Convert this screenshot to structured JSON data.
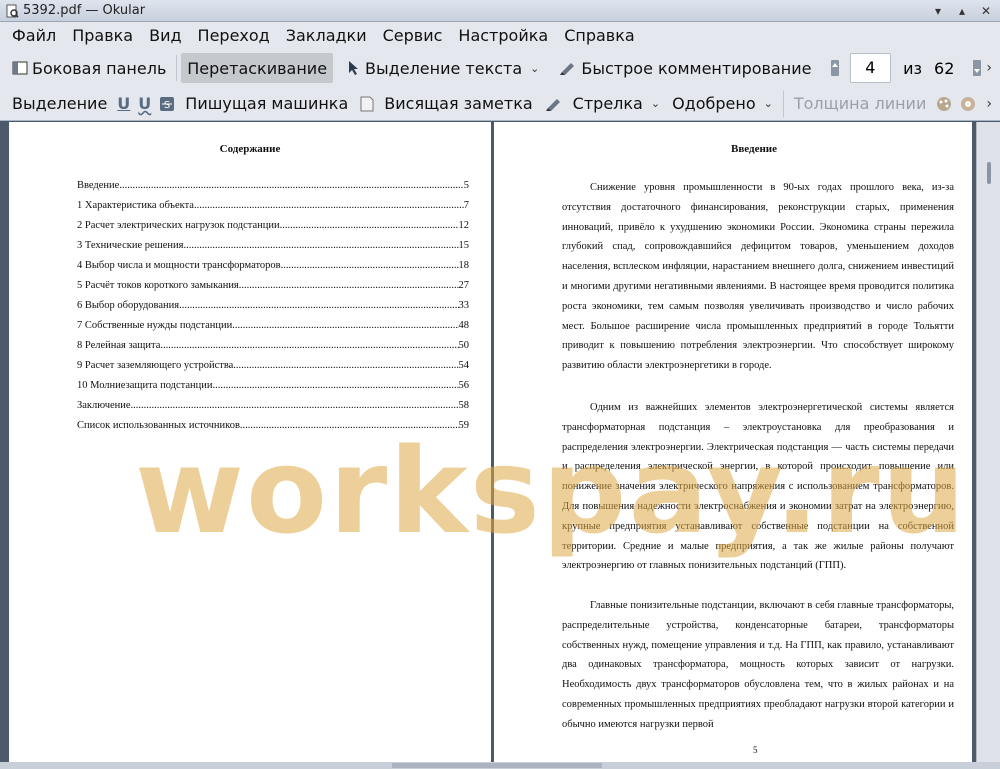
{
  "window": {
    "title": "5392.pdf  — Okular"
  },
  "menubar": [
    "Файл",
    "Правка",
    "Вид",
    "Переход",
    "Закладки",
    "Сервис",
    "Настройка",
    "Справка"
  ],
  "toolbar1": {
    "sidebar": "Боковая панель",
    "drag": "Перетаскивание",
    "text_select": "Выделение текста",
    "quick_comment": "Быстрое комментирование",
    "page_current": "4",
    "page_of": "из",
    "page_total": "62"
  },
  "toolbar2": {
    "highlight": "Выделение",
    "typewriter": "Пишущая машинка",
    "note": "Висящая заметка",
    "arrow": "Стрелка",
    "stamp": "Одобрено",
    "line_width": "Толщина линии"
  },
  "left_page": {
    "heading": "Содержание",
    "toc": [
      {
        "title": "Введение",
        "page": "5"
      },
      {
        "title": "1 Характеристика объекта",
        "page": "7"
      },
      {
        "title": "2 Расчет электрических нагрузок подстанции",
        "page": "12"
      },
      {
        "title": "3 Технические решения",
        "page": "15"
      },
      {
        "title": "4 Выбор числа и мощности трансформаторов",
        "page": "18"
      },
      {
        "title": "5 Расчёт токов короткого замыкания",
        "page": "27"
      },
      {
        "title": "6 Выбор оборудования",
        "page": "33"
      },
      {
        "title": "7 Собственные нужды подстанции",
        "page": "48"
      },
      {
        "title": "8 Релейная защита",
        "page": "50"
      },
      {
        "title": "9 Расчет заземляющего устройства",
        "page": "54"
      },
      {
        "title": "10 Молниезащита подстанции",
        "page": "56"
      },
      {
        "title": "Заключение",
        "page": "58"
      },
      {
        "title": "Список использованных источников",
        "page": "59"
      }
    ]
  },
  "right_page": {
    "heading": "Введение",
    "paragraphs": [
      "Снижение уровня промышленности в 90-ых годах прошлого века, из-за отсутствия достаточного финансирования, реконструкции старых, применения инноваций, привёло к ухудшению экономики России. Экономика страны пережила глубокий спад, сопровождавшийся дефицитом товаров, уменьшением доходов населения, всплеском инфляции, нарастанием внешнего долга, снижением инвестиций и многими другими негативными явлениями. В настоящее время проводится политика роста экономики, тем самым позволяя увеличивать производство и число рабочих мест.  Большое расширение числа промышленных предприятий в городе Тольятти приводит к повышению потребления электроэнергии. Что способствует широкому развитию области электроэнергетики в городе.",
      "Одним из важнейших элементов электроэнергетической системы является трансформаторная подстанция – электроустановка для преобразования и распределения электроэнергии. Электрическая подстанция — часть системы передачи и распределения электрической энергии, в которой происходит повышение или понижение значения электрического напряжения с использованием трансформаторов. Для повышения надежности электроснабжения и экономии затрат на электроэнергию, крупные предприятия устанавливают собственные подстанции на собственной территории. Средние и малые предприятия, а так же жилые районы получают электроэнергию от главных понизительных подстанций (ГПП).",
      "Главные понизительные подстанции, включают в себя главные трансформаторы, распределительные устройства, конденсаторные батареи, трансформаторы собственных нужд, помещение управления и т.д. На ГПП, как правило, устанавливают два одинаковых трансформатора, мощность которых зависит от нагрузки. Необходимость двух трансформаторов обусловлена тем, что в жилых районах и на современных промышленных предприятиях преобладают нагрузки второй категории и обычно имеются нагрузки первой"
    ],
    "page_number": "5"
  },
  "watermark": "workspay.ru"
}
